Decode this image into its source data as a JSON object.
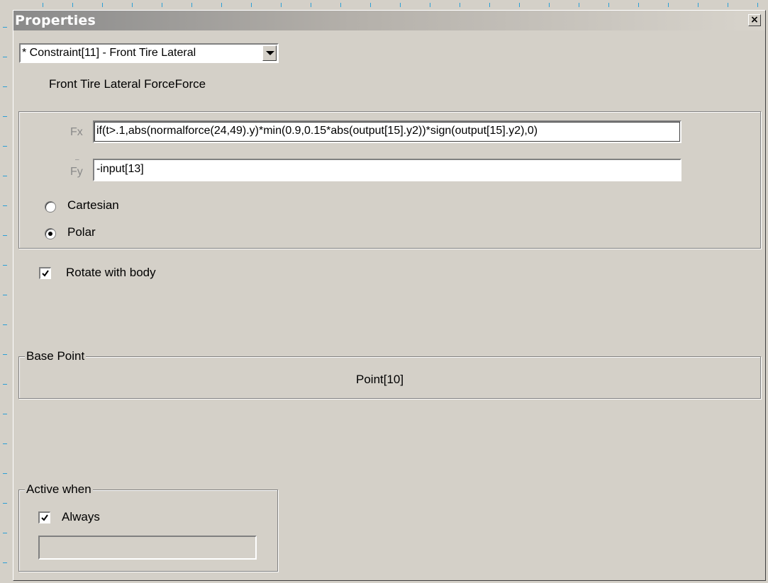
{
  "window": {
    "title": "Properties",
    "close_glyph": "×"
  },
  "object_selector": {
    "value": "* Constraint[11] - Front Tire Lateral"
  },
  "description": "Front Tire Lateral ForceForce",
  "force": {
    "fx_label": "Fx",
    "fx_value": "if(t>.1,abs(normalforce(24,49).y)*min(0.9,0.15*abs(output[15].y2))*sign(output[15].y2),0)",
    "fy_label": "Fy",
    "fy_value": "-input[13]",
    "coord_options": [
      {
        "label": "Cartesian",
        "selected": false
      },
      {
        "label": "Polar",
        "selected": true
      }
    ]
  },
  "rotate_with_body": {
    "label": "Rotate with body",
    "checked": true
  },
  "base_point": {
    "legend": "Base Point",
    "value": "Point[10]"
  },
  "active_when": {
    "legend": "Active when",
    "always": {
      "label": "Always",
      "checked": true
    },
    "condition_value": ""
  },
  "icons": {
    "close": "close-icon",
    "dropdown": "chevron-down-icon",
    "check": "checkmark-icon"
  }
}
